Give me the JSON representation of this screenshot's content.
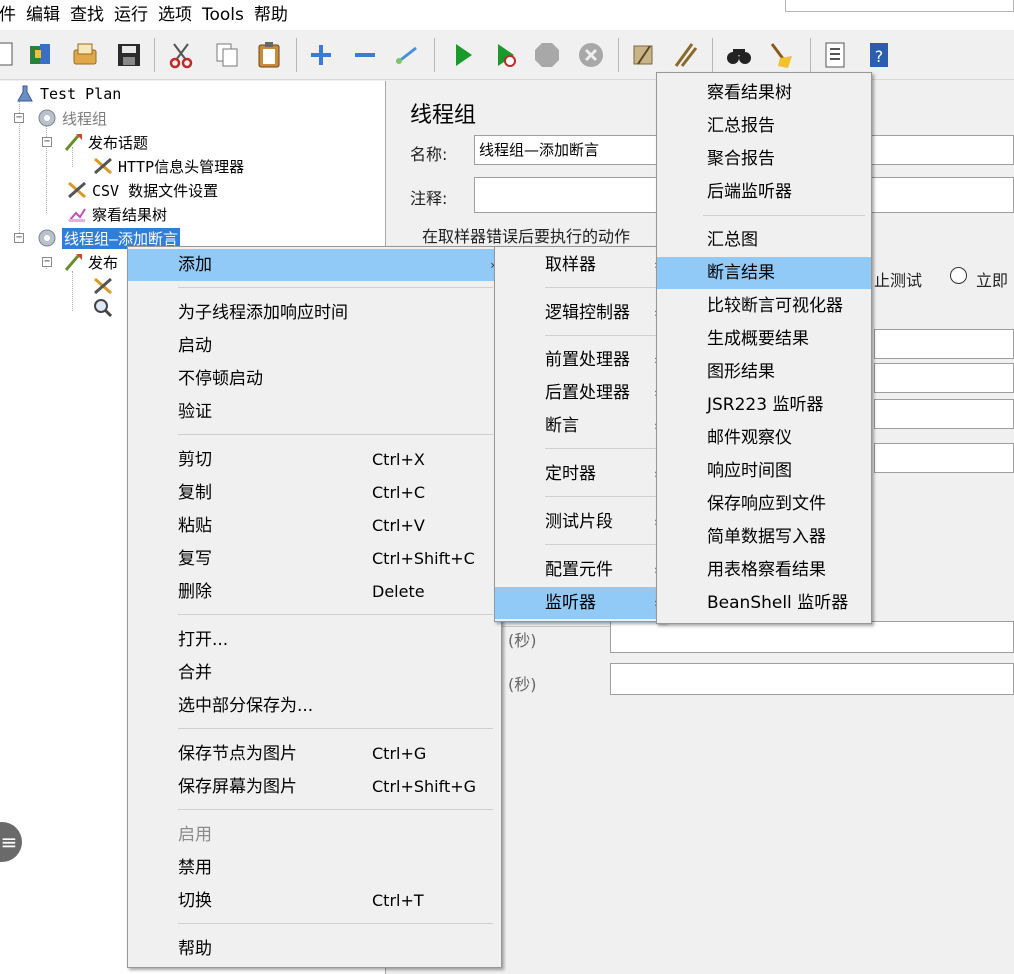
{
  "menubar": {
    "items": [
      "件",
      "编辑",
      "查找",
      "运行",
      "选项",
      "Tools",
      "帮助"
    ]
  },
  "toolbar": {
    "icons": [
      "new-icon",
      "template-icon",
      "open-icon",
      "save-icon",
      "cut-icon",
      "copy-icon",
      "paste-icon",
      "expand-icon",
      "collapse-icon",
      "toggle-icon",
      "start-icon",
      "start-no-pause-icon",
      "stop-icon",
      "shutdown-icon",
      "clear-icon",
      "clear-all-icon",
      "search-icon",
      "reset-search-icon",
      "function-helper-icon",
      "help-icon"
    ]
  },
  "tree": {
    "nodes": [
      {
        "label": "Test Plan",
        "icon": "test-plan-icon"
      },
      {
        "label": "线程组",
        "icon": "thread-group-icon",
        "disabled": true
      },
      {
        "label": "发布话题",
        "icon": "sampler-icon"
      },
      {
        "label": "HTTP信息头管理器",
        "icon": "config-tool-icon"
      },
      {
        "label": "CSV 数据文件设置",
        "icon": "config-tool-icon"
      },
      {
        "label": "察看结果树",
        "icon": "listener-icon"
      },
      {
        "label": "线程组—添加断言",
        "icon": "thread-group-icon",
        "selected": true
      },
      {
        "label": "发布",
        "icon": "sampler-icon"
      },
      {
        "label": "",
        "icon": "config-tool-icon"
      },
      {
        "label": "",
        "icon": "magnifier-icon"
      }
    ]
  },
  "panel": {
    "title": "线程组",
    "name_label": "名称:",
    "name_value": "线程组—添加断言",
    "comment_label": "注释:",
    "comment_value": "",
    "error_action_label": "在取样器错误后要执行的动作",
    "stop_test_label": "止测试",
    "stop_now_label": "立即",
    "sec_label_1": "(秒)",
    "sec_label_2": "(秒)"
  },
  "context_menu": {
    "items": [
      {
        "label": "添加",
        "submenu": true,
        "highlighted": true
      },
      {
        "label": "为子线程添加响应时间"
      },
      {
        "label": "启动"
      },
      {
        "label": "不停顿启动"
      },
      {
        "label": "验证"
      },
      {
        "label": "剪切",
        "shortcut": "Ctrl+X"
      },
      {
        "label": "复制",
        "shortcut": "Ctrl+C"
      },
      {
        "label": "粘贴",
        "shortcut": "Ctrl+V"
      },
      {
        "label": "复写",
        "shortcut": "Ctrl+Shift+C"
      },
      {
        "label": "删除",
        "shortcut": "Delete"
      },
      {
        "label": "打开..."
      },
      {
        "label": "合并"
      },
      {
        "label": "选中部分保存为..."
      },
      {
        "label": "保存节点为图片",
        "shortcut": "Ctrl+G"
      },
      {
        "label": "保存屏幕为图片",
        "shortcut": "Ctrl+Shift+G"
      },
      {
        "label": "启用",
        "disabled": true
      },
      {
        "label": "禁用"
      },
      {
        "label": "切换",
        "shortcut": "Ctrl+T"
      },
      {
        "label": "帮助"
      }
    ]
  },
  "add_submenu": {
    "items": [
      {
        "label": "取样器"
      },
      {
        "label": "逻辑控制器"
      },
      {
        "label": "前置处理器"
      },
      {
        "label": "后置处理器"
      },
      {
        "label": "断言"
      },
      {
        "label": "定时器"
      },
      {
        "label": "测试片段"
      },
      {
        "label": "配置元件"
      },
      {
        "label": "监听器",
        "highlighted": true
      }
    ]
  },
  "listener_submenu": {
    "items": [
      {
        "label": "察看结果树"
      },
      {
        "label": "汇总报告"
      },
      {
        "label": "聚合报告"
      },
      {
        "label": "后端监听器"
      },
      {
        "label": "汇总图"
      },
      {
        "label": "断言结果",
        "highlighted": true
      },
      {
        "label": "比较断言可视化器"
      },
      {
        "label": "生成概要结果"
      },
      {
        "label": "图形结果"
      },
      {
        "label": "JSR223 监听器"
      },
      {
        "label": "邮件观察仪"
      },
      {
        "label": "响应时间图"
      },
      {
        "label": "保存响应到文件"
      },
      {
        "label": "简单数据写入器"
      },
      {
        "label": "用表格察看结果"
      },
      {
        "label": "BeanShell 监听器"
      }
    ]
  },
  "colors": {
    "selection": "#2f7fd8",
    "menu_highlight": "#91c9f7",
    "start_green": "#1a9a2a"
  }
}
